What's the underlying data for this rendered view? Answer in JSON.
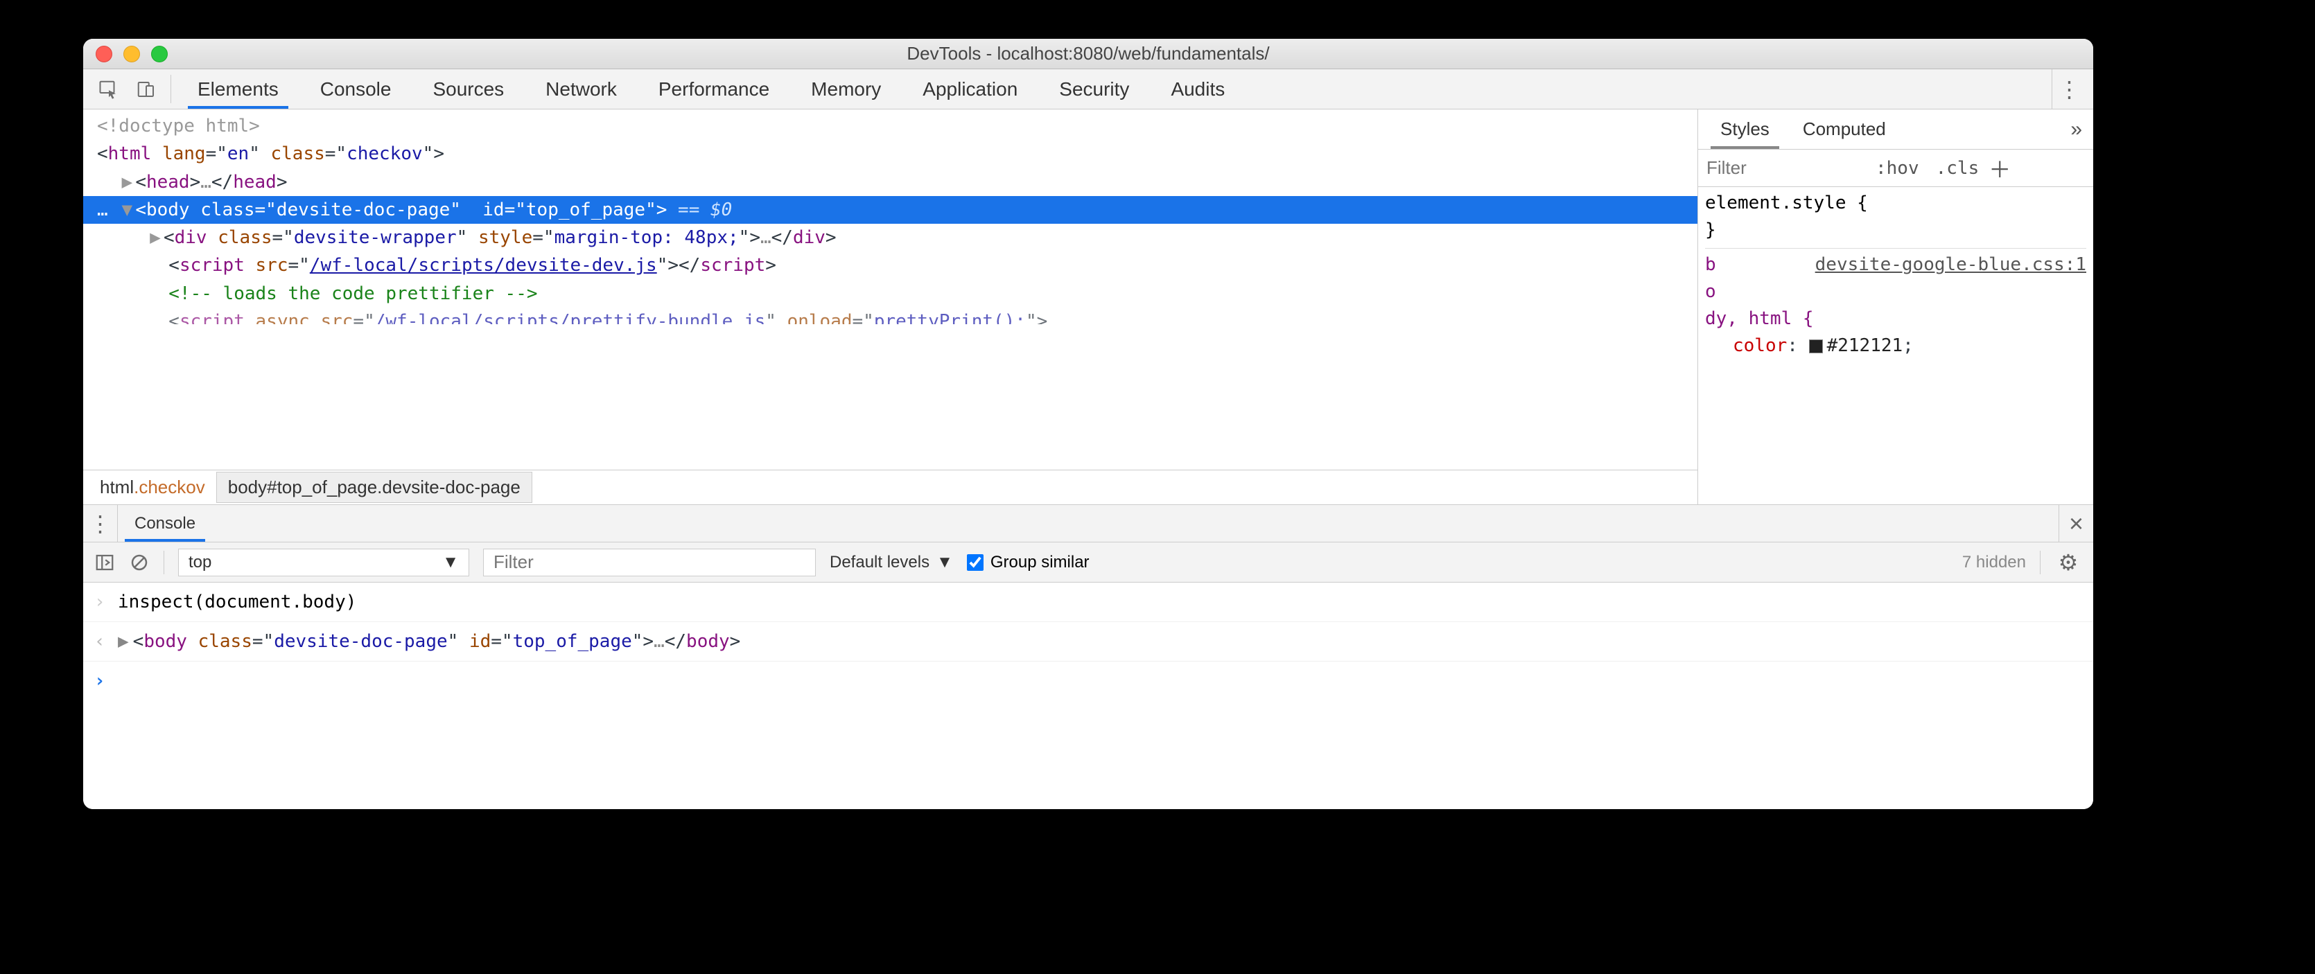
{
  "window_title": "DevTools - localhost:8080/web/fundamentals/",
  "tabs": [
    "Elements",
    "Console",
    "Sources",
    "Network",
    "Performance",
    "Memory",
    "Application",
    "Security",
    "Audits"
  ],
  "active_tab": "Elements",
  "styles_tabs": [
    "Styles",
    "Computed"
  ],
  "styles_active": "Styles",
  "filter_placeholder": "Filter",
  "hov_label": ":hov",
  "cls_label": ".cls",
  "element_style_label": "element.style {",
  "element_style_close": "}",
  "rule_link": "devsite-google-blue.css:1",
  "rule_sel_parts": [
    "b",
    "o",
    "dy, html {"
  ],
  "rule_prop": "color",
  "rule_val": "#212121",
  "rule_val_swatch": "#212121",
  "rule_close": ";",
  "dom": {
    "doctype": "<!doctype html>",
    "html_open_pre": "<",
    "html_tag": "html",
    "html_attr1_name": "lang",
    "html_attr1_val": "en",
    "html_attr2_name": "class",
    "html_attr2_val": "checkov",
    "head": {
      "tag": "head",
      "ellipsis": "…"
    },
    "body_sel": {
      "dots": "…",
      "tag": "body",
      "class_name": "class",
      "class_val": "devsite-doc-page",
      "id_name": "id",
      "id_val": "top_of_page",
      "hint": "== $0"
    },
    "div": {
      "tag": "div",
      "class_name": "class",
      "class_val": "devsite-wrapper",
      "style_name": "style",
      "style_val": "margin-top: 48px;",
      "ellipsis": "…"
    },
    "script1": {
      "tag": "script",
      "src_name": "src",
      "src_val": "/wf-local/scripts/devsite-dev.js"
    },
    "comment": "<!-- loads the code prettifier -->",
    "script2": {
      "tag": "script",
      "async": "async",
      "src_name": "src",
      "src_val": "/wf-local/scripts/prettify-bundle.js",
      "onload_name": "onload",
      "onload_val": "prettyPrint();"
    }
  },
  "crumb1_tag": "html",
  "crumb1_cls": ".checkov",
  "crumb2": "body#top_of_page.devsite-doc-page",
  "drawer_tab": "Console",
  "context": "top",
  "console_filter_placeholder": "Filter",
  "levels_label": "Default levels",
  "group_label": "Group similar",
  "hidden_label": "7 hidden",
  "console_input": "inspect(document.body)",
  "console_result": {
    "tag": "body",
    "class_name": "class",
    "class_val": "devsite-doc-page",
    "id_name": "id",
    "id_val": "top_of_page",
    "ellipsis": "…"
  }
}
